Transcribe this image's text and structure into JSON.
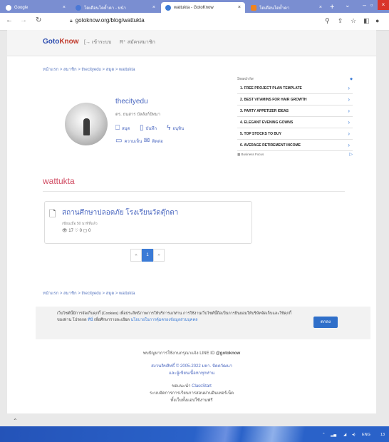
{
  "browser": {
    "tabs": [
      {
        "label": "Google",
        "fav_color": "#ffffff",
        "close": "×"
      },
      {
        "label": "โดเดือนโดย้ำคา - หน้า",
        "fav_color": "#4a78d6",
        "close": "×"
      },
      {
        "label": "wattukta - GotoKnow",
        "fav_color": "#3b7bd6",
        "close": "×"
      },
      {
        "label": "โดเดือนโดย้ำคา",
        "fav_color": "#f0831e",
        "close": "×"
      }
    ],
    "new_tab": "+",
    "url": "gotoknow.org/blog/wattukta"
  },
  "site": {
    "logo_go": "Goto",
    "logo_know": "Know",
    "login": "เข้าระบบ",
    "signup": "สมัครสมาชิก"
  },
  "breadcrumb_top": "หน้าแรก > สมาชิก > thecityedu > สมุด > wattukta",
  "profile": {
    "name": "thecityedu",
    "subtitle": "ดร. ธนสาร บัลลังก์ปัทมา",
    "links": {
      "books": "สมุด",
      "records": "บันทึก",
      "memo": "อนุทิน",
      "comments": "ความเห็น",
      "contact": "ติดต่อ"
    }
  },
  "ad": {
    "header": "Search for",
    "items": [
      "1. FREE PROJECT PLAN TEMPLATE",
      "2. BEST VITAMINS FOR HAIR GROWTH",
      "3. PARTY APPETIZER IDEAS",
      "4. ELEGANT EVENING GOWNS",
      "5. TOP STOCKS TO BUY",
      "6. AVERAGE RETIREMENT INCOME"
    ],
    "footer": "Business Focus"
  },
  "blog": {
    "title": "wattukta",
    "post_title": "สถานศึกษาปลอดภัย โรงเรียนวัดตุ๊กตา",
    "post_time": "เขียนเมื่อ 50 นาทีที่แล้ว",
    "post_stats": "👁 17 ♡ 0 ▢ 0"
  },
  "pagination": {
    "prev": "«",
    "current": "1",
    "next": "»"
  },
  "breadcrumb_bottom": "หน้าแรก > สมาชิก > thecityedu > สมุด > wattukta",
  "cookie": {
    "text": "เว็บไซต์นี้มีการจัดเก็บคุกกี้ (Cookies) เพื่อประสิทธิภาพการให้บริการแก่ท่าน การใช้งานเว็บไซต์นี้ถือเป็นการยินยอมให้บริษัทจัดเก็บและใช้คุกกี้ของท่าน โปรดกด",
    "link1": "ที่นี่",
    "text2": "เพื่อศึกษารายละเอียด",
    "link2": "นโยบายในการคุ้มครองข้อมูลส่วนบุคคล",
    "ok": "ตกลง"
  },
  "footer": {
    "line_id_prefix": "พบปัญหาการใช้งานกรุณาแจ้ง LINE ID",
    "line_id": "@gotoknow",
    "copyright": "สงวนลิขสิทธิ์ © 2005-2022 มหา. ปัตตวัฒนา",
    "terms": "และผู้เขียนเนื้อหาทุกท่าน",
    "partner_prefix": "ขอแนะนำ",
    "partner": "ClassStart",
    "partner_desc1": "ระบบจัดการการเรียนการสอนผ่านอินเทอร์เน็ต",
    "partner_desc2": "ทั้งเว็บทั้งแอปใช้งานฟรี"
  },
  "taskbar": {
    "lang": "ENG",
    "time": "13"
  }
}
